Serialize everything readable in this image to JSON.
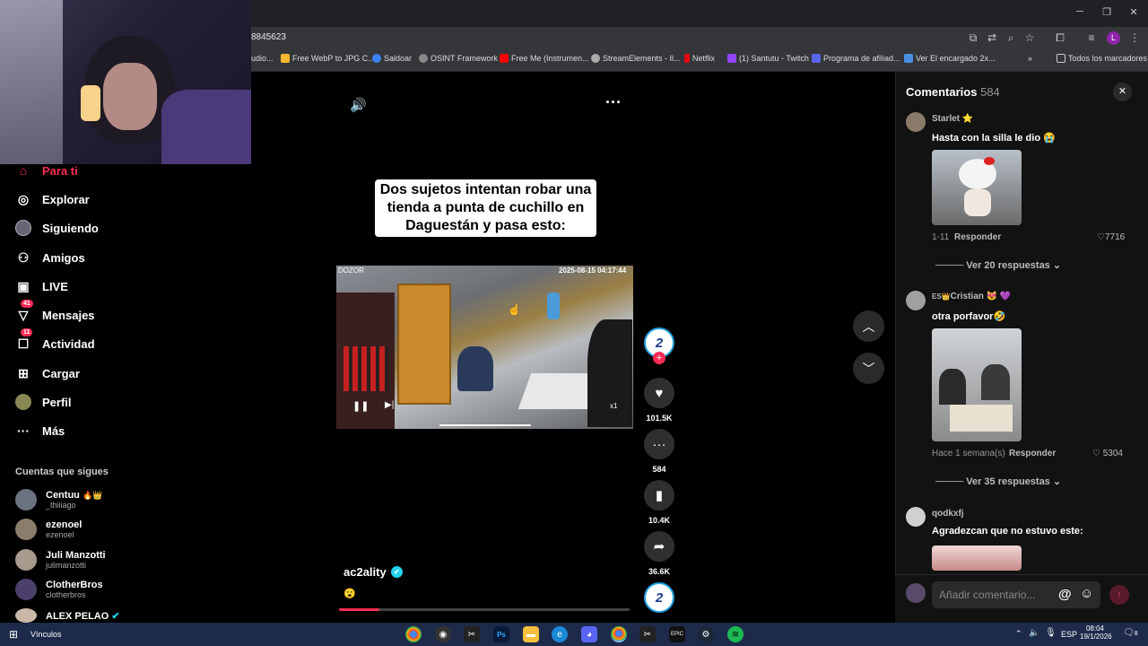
{
  "browser": {
    "url": "8845623",
    "bookmarks": [
      {
        "label": "udio...",
        "color": "#e07a2f"
      },
      {
        "label": "Free WebP to JPG C...",
        "color": "#f3b82c"
      },
      {
        "label": "Saldoar",
        "color": "#3b82f6"
      },
      {
        "label": "OSINT Framework",
        "color": "#888888"
      },
      {
        "label": "Free Me (Instrumen...",
        "color": "#ff0000"
      },
      {
        "label": "StreamElements - Il...",
        "color": "#aaaaaa"
      },
      {
        "label": "Netflix",
        "color": "#e50914"
      },
      {
        "label": "(1) Santutu - Twitch",
        "color": "#9146ff"
      },
      {
        "label": "Programa de afiliad...",
        "color": "#5865f2"
      },
      {
        "label": "Ver El encargado 2x...",
        "color": "#4a90e2"
      }
    ],
    "all_bookmarks": "Todos los marcadores",
    "profile_initial": "L"
  },
  "sidebar": {
    "nav": [
      {
        "label": "Para ti",
        "icon": "home-icon",
        "active": true,
        "badge": ""
      },
      {
        "label": "Explorar",
        "icon": "compass-icon",
        "active": false,
        "badge": ""
      },
      {
        "label": "Siguiendo",
        "icon": "following-icon",
        "active": false,
        "badge": ""
      },
      {
        "label": "Amigos",
        "icon": "friends-icon",
        "active": false,
        "badge": ""
      },
      {
        "label": "LIVE",
        "icon": "live-icon",
        "active": false,
        "badge": ""
      },
      {
        "label": "Mensajes",
        "icon": "messages-icon",
        "active": false,
        "badge": "41"
      },
      {
        "label": "Actividad",
        "icon": "activity-icon",
        "active": false,
        "badge": "11"
      },
      {
        "label": "Cargar",
        "icon": "upload-icon",
        "active": false,
        "badge": ""
      },
      {
        "label": "Perfil",
        "icon": "profile-icon",
        "active": false,
        "badge": ""
      },
      {
        "label": "Más",
        "icon": "more-icon",
        "active": false,
        "badge": ""
      }
    ],
    "following_title": "Cuentas que sigues",
    "accounts": [
      {
        "name": "Centuu",
        "emoji": "🔥👑",
        "handle": "_thiiiago"
      },
      {
        "name": "ezenoel",
        "emoji": "",
        "handle": "ezenoel"
      },
      {
        "name": "Juli Manzotti",
        "emoji": "",
        "handle": "julimanzotti"
      },
      {
        "name": "ClotherBros",
        "emoji": "",
        "handle": "clotherbros"
      },
      {
        "name": "ALEX PELAO",
        "emoji": "",
        "handle": ""
      }
    ]
  },
  "video": {
    "caption": "Dos sujetos intentan robar una tienda a punta de cuchillo en Daguestán y pasa esto:",
    "overlay_left": "DOZOR",
    "overlay_right": "2025-08-15 04:17:44",
    "speed": "x1",
    "author": "ac2ality",
    "description_emoji": "😮",
    "likes": "101.5K",
    "comments": "584",
    "saves": "10.4K",
    "shares": "36.6K",
    "avatar_label": "2"
  },
  "comments": {
    "title": "Comentarios",
    "count": "584",
    "items": [
      {
        "user": "Starlet",
        "badge": "⭐",
        "text": "Hasta con la silla le dio 😭",
        "date": "1-11",
        "reply": "Responder",
        "likes": "7716",
        "more": "Ver 20 respuestas"
      },
      {
        "user": "Cristian",
        "badge": "😻 💜",
        "prefix": "ES👑",
        "text": "otra porfavor🤣",
        "date": "Hace 1 semana(s)",
        "reply": "Responder",
        "likes": "5304",
        "more": "Ver 35 respuestas"
      },
      {
        "user": "qodkxfj",
        "badge": "",
        "text": "Agradezcan que no estuvo este:",
        "date": "",
        "reply": "",
        "likes": "",
        "more": ""
      }
    ],
    "input_placeholder": "Añadir comentario...",
    "mention": "@"
  },
  "taskbar": {
    "label": "Vínculos",
    "lang": "ESP",
    "time": "08:04",
    "date": "19/1/2026",
    "notif": "8"
  }
}
